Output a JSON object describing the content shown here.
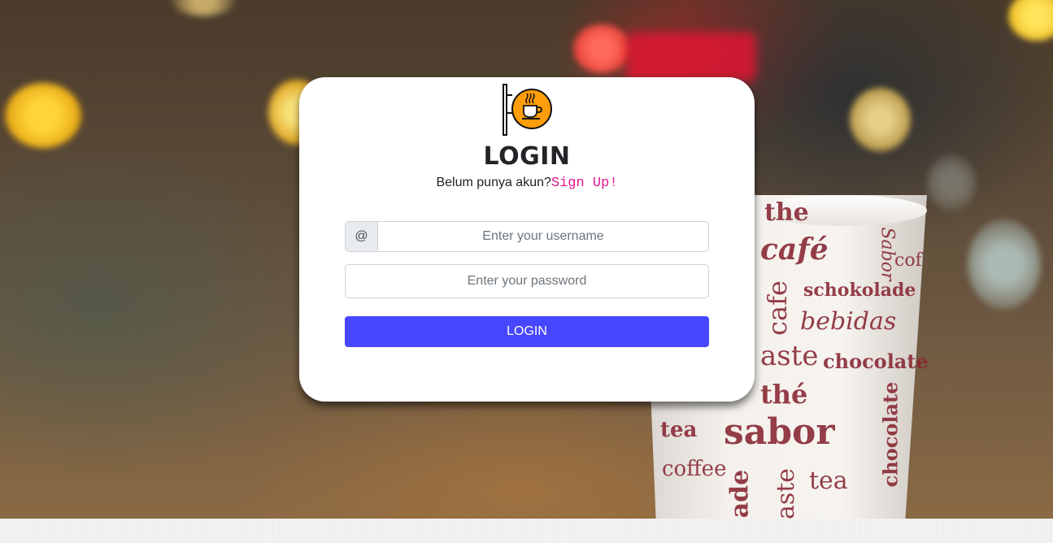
{
  "login_card": {
    "title": "LOGIN",
    "subtitle_text": "Belum punya akun?",
    "signup_link": "Sign Up!",
    "username": {
      "addon": "@",
      "placeholder": "Enter your username",
      "value": ""
    },
    "password": {
      "placeholder": "Enter your password",
      "value": ""
    },
    "submit_label": "LOGIN"
  },
  "logo": {
    "icon": "coffee-cup-sign-icon",
    "accent_color": "#ff9d0a"
  },
  "background": {
    "cup_words": [
      "the",
      "café",
      "Sabor",
      "cof",
      "cafe",
      "schokolade",
      "bebidas",
      "aste",
      "chocolate",
      "thé",
      "tea",
      "sabor",
      "chocolate",
      "coffee",
      "ade",
      "aste",
      "tea",
      "tea"
    ]
  },
  "colors": {
    "primary_button": "#4747ff",
    "signup_link": "#e3178f",
    "title": "#222428"
  }
}
